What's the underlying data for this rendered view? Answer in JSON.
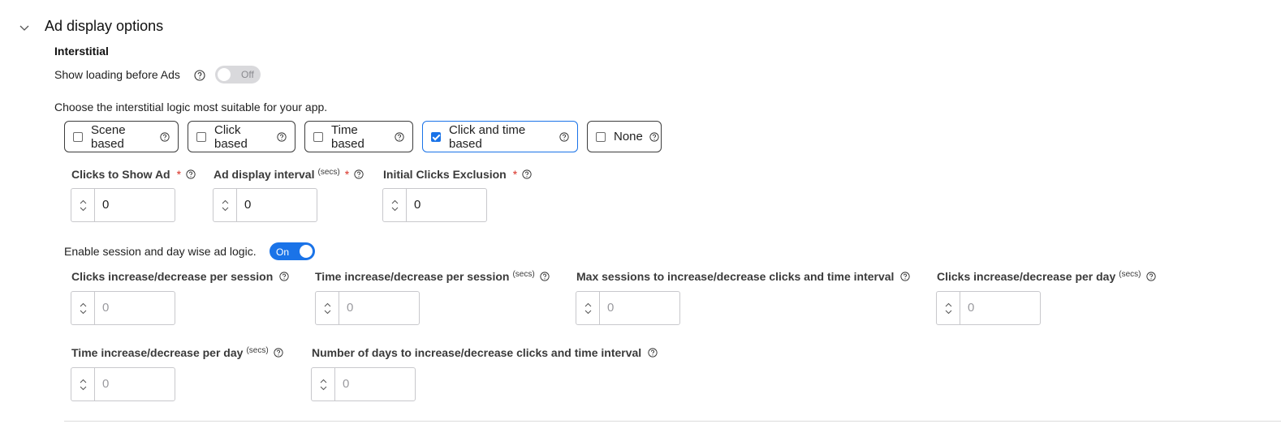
{
  "section": {
    "title": "Ad display options",
    "subtitle": "Interstitial"
  },
  "loading": {
    "label": "Show loading before Ads",
    "toggle_text": "Off"
  },
  "logic": {
    "prompt": "Choose the interstitial logic most suitable for your app.",
    "options": [
      {
        "label": "Scene based",
        "checked": false
      },
      {
        "label": "Click based",
        "checked": false
      },
      {
        "label": "Time based",
        "checked": false
      },
      {
        "label": "Click and time based",
        "checked": true
      },
      {
        "label": "None",
        "checked": false
      }
    ]
  },
  "fields_primary": [
    {
      "label": "Clicks to Show Ad",
      "unit": "",
      "required": "*",
      "value": "0"
    },
    {
      "label": "Ad display interval",
      "unit": "(secs)",
      "required": "*",
      "value": "0"
    },
    {
      "label": "Initial Clicks Exclusion",
      "unit": "",
      "required": "*",
      "value": "0"
    }
  ],
  "session": {
    "label": "Enable session and day wise ad logic.",
    "toggle_text": "On"
  },
  "fields_session": [
    {
      "label": "Clicks increase/decrease per session",
      "unit": "",
      "placeholder": "0"
    },
    {
      "label": "Time increase/decrease per session",
      "unit": "(secs)",
      "placeholder": "0"
    },
    {
      "label": "Max sessions to increase/decrease clicks and time interval",
      "unit": "",
      "placeholder": "0"
    },
    {
      "label": "Clicks increase/decrease per day",
      "unit": "(secs)",
      "placeholder": "0"
    },
    {
      "label": "Time increase/decrease per day",
      "unit": "(secs)",
      "placeholder": "0"
    },
    {
      "label": "Number of days to increase/decrease clicks and time interval",
      "unit": "",
      "placeholder": "0"
    }
  ],
  "colors": {
    "accent": "#1a73e8",
    "required": "#d93025"
  }
}
